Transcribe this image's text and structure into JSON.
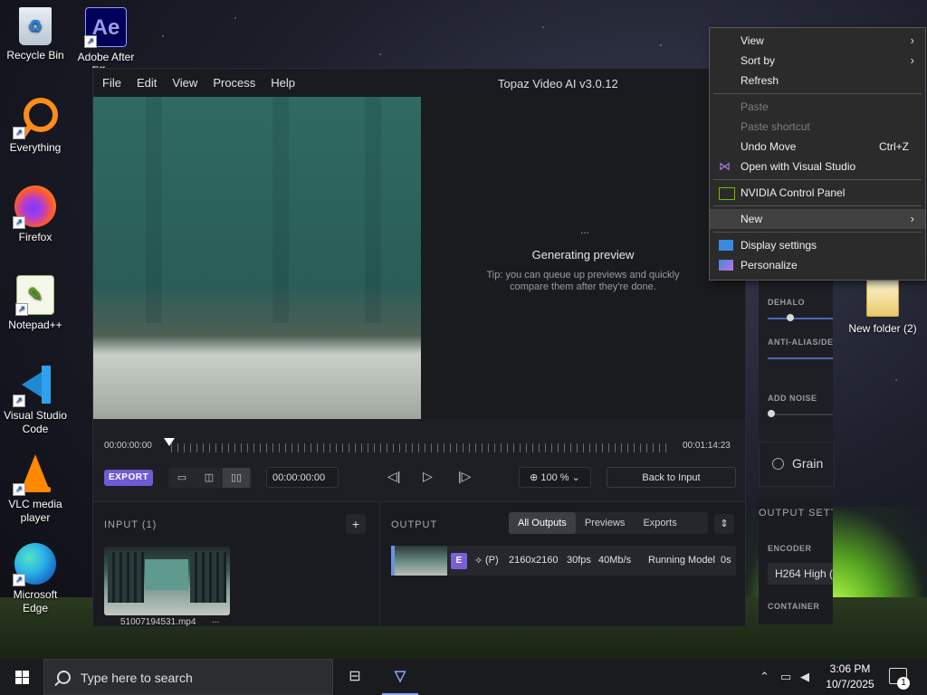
{
  "desktop": {
    "icons": [
      {
        "label": "Recycle Bin"
      },
      {
        "label": "Adobe After Effe..."
      },
      {
        "label": "Everything"
      },
      {
        "label": "Firefox"
      },
      {
        "label": "Notepad++"
      },
      {
        "label": "Visual Studio Code"
      },
      {
        "label": "VLC media player"
      },
      {
        "label": "Microsoft Edge"
      }
    ],
    "folder_label": "New folder (2)",
    "ae_glyph": "Ae"
  },
  "app": {
    "menu": [
      "File",
      "Edit",
      "View",
      "Process",
      "Help"
    ],
    "title": "Topaz Video AI  v3.0.12",
    "preview": {
      "dots": "...",
      "title": "Generating preview",
      "tip": "Tip: you can queue up previews and quickly compare them after they're done."
    },
    "timeline": {
      "start": "00:00:00:00",
      "end": "00:01:14:23"
    },
    "controls": {
      "export": "EXPORT",
      "time_value": "00:00:00:00",
      "zoom": "100 %",
      "back": "Back to Input"
    },
    "input": {
      "header": "INPUT (1)",
      "add": "+",
      "file": "51007194531.mp4",
      "more": "..."
    },
    "output": {
      "header": "OUTPUT",
      "tabs": [
        "All Outputs",
        "Previews",
        "Exports"
      ],
      "row": {
        "badge": "E",
        "mode": "(P)",
        "resolution": "2160x2160",
        "fps": "30fps",
        "bitrate": "40Mb/s",
        "status": "Running Model",
        "elapsed": "0s"
      }
    },
    "side": {
      "dehalo": "DEHALO",
      "antialias": "ANTI-ALIAS/DEI",
      "add_noise": "ADD NOISE",
      "grain": "Grain",
      "output_settings": "OUTPUT SETT",
      "encoder_label": "ENCODER",
      "encoder_value": "H264 High (",
      "container_label": "CONTAINER"
    }
  },
  "context_menu": {
    "items": [
      {
        "label": "View",
        "submenu": true
      },
      {
        "label": "Sort by",
        "submenu": true
      },
      {
        "label": "Refresh"
      },
      {
        "label": "Paste",
        "disabled": true
      },
      {
        "label": "Paste shortcut",
        "disabled": true
      },
      {
        "label": "Undo Move",
        "shortcut": "Ctrl+Z"
      },
      {
        "label": "Open with Visual Studio"
      },
      {
        "label": "NVIDIA Control Panel"
      },
      {
        "label": "New",
        "submenu": true
      },
      {
        "label": "Display settings"
      },
      {
        "label": "Personalize"
      }
    ]
  },
  "taskbar": {
    "search_placeholder": "Type here to search",
    "time": "3:06 PM",
    "date": "10/7/2025",
    "notification_count": "1"
  }
}
